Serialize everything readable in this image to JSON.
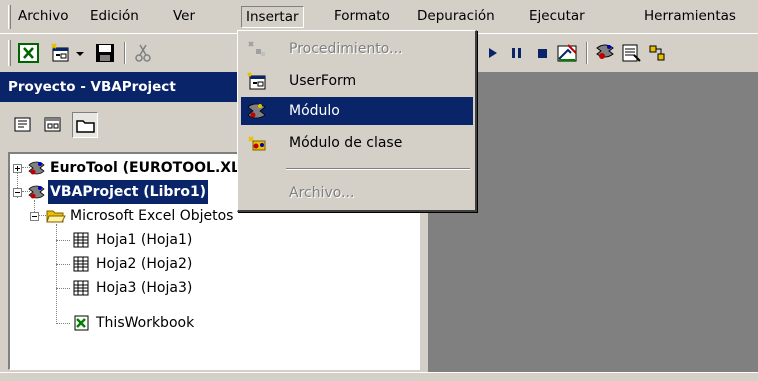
{
  "menubar": {
    "items": [
      {
        "label": "Archivo"
      },
      {
        "label": "Edición"
      },
      {
        "label": "Ver"
      },
      {
        "label": "Insertar"
      },
      {
        "label": "Formato"
      },
      {
        "label": "Depuración"
      },
      {
        "label": "Ejecutar"
      },
      {
        "label": "Herramientas"
      }
    ]
  },
  "insert_menu": {
    "items": [
      {
        "label": "Procedimiento...",
        "enabled": false
      },
      {
        "label": "UserForm",
        "enabled": true
      },
      {
        "label": "Módulo",
        "enabled": true,
        "highlighted": true
      },
      {
        "label": "Módulo de clase",
        "enabled": true
      },
      {
        "label": "Archivo...",
        "enabled": false
      }
    ]
  },
  "project_panel": {
    "title": "Proyecto - VBAProject"
  },
  "tree": {
    "nodes": [
      {
        "label": "EuroTool (EUROTOOL.XLA)"
      },
      {
        "label": "VBAProject (Libro1)"
      },
      {
        "label": "Microsoft Excel Objetos"
      },
      {
        "label": "Hoja1 (Hoja1)"
      },
      {
        "label": "Hoja2 (Hoja2)"
      },
      {
        "label": "Hoja3 (Hoja3)"
      },
      {
        "label": "ThisWorkbook"
      }
    ]
  },
  "colors": {
    "face": "#d4d0c8",
    "selection": "#0a246a",
    "workspace": "#808080"
  }
}
